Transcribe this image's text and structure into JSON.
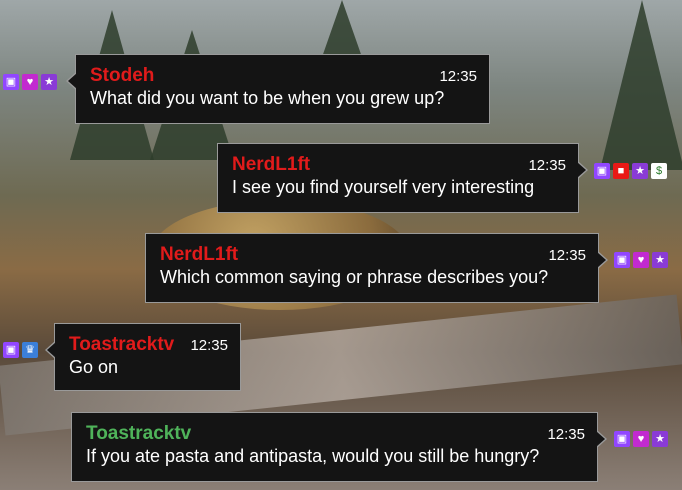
{
  "colors": {
    "bubble_bg": "#141414",
    "bubble_border": "#9a9a9a",
    "name_red": "#e11b1b",
    "name_green": "#4fb35a",
    "text": "#ffffff"
  },
  "messages": [
    {
      "name": "Stodeh",
      "name_color": "#e11b1b",
      "time": "12:35",
      "text": "What did you want to be when you grew up?",
      "badges": [
        "twitch-icon",
        "heart-icon",
        "star-icon"
      ]
    },
    {
      "name": "NerdL1ft",
      "name_color": "#e11b1b",
      "time": "12:35",
      "text": "I see you find yourself very interesting",
      "badges": [
        "twitch-icon",
        "camera-icon",
        "star-icon",
        "money-icon"
      ]
    },
    {
      "name": "NerdL1ft",
      "name_color": "#e11b1b",
      "time": "12:35",
      "text": "Which common saying or phrase describes you?",
      "badges": [
        "twitch-icon",
        "heart-icon",
        "star-icon"
      ]
    },
    {
      "name": "Toastracktv",
      "name_color": "#e11b1b",
      "time": "12:35",
      "text": "Go on",
      "badges": [
        "twitch-icon",
        "crown-icon"
      ]
    },
    {
      "name": "Toastracktv",
      "name_color": "#4fb35a",
      "time": "12:35",
      "text": "If you ate pasta and antipasta, would you still be hungry?",
      "badges": [
        "twitch-icon",
        "heart-icon",
        "star-icon"
      ]
    }
  ]
}
